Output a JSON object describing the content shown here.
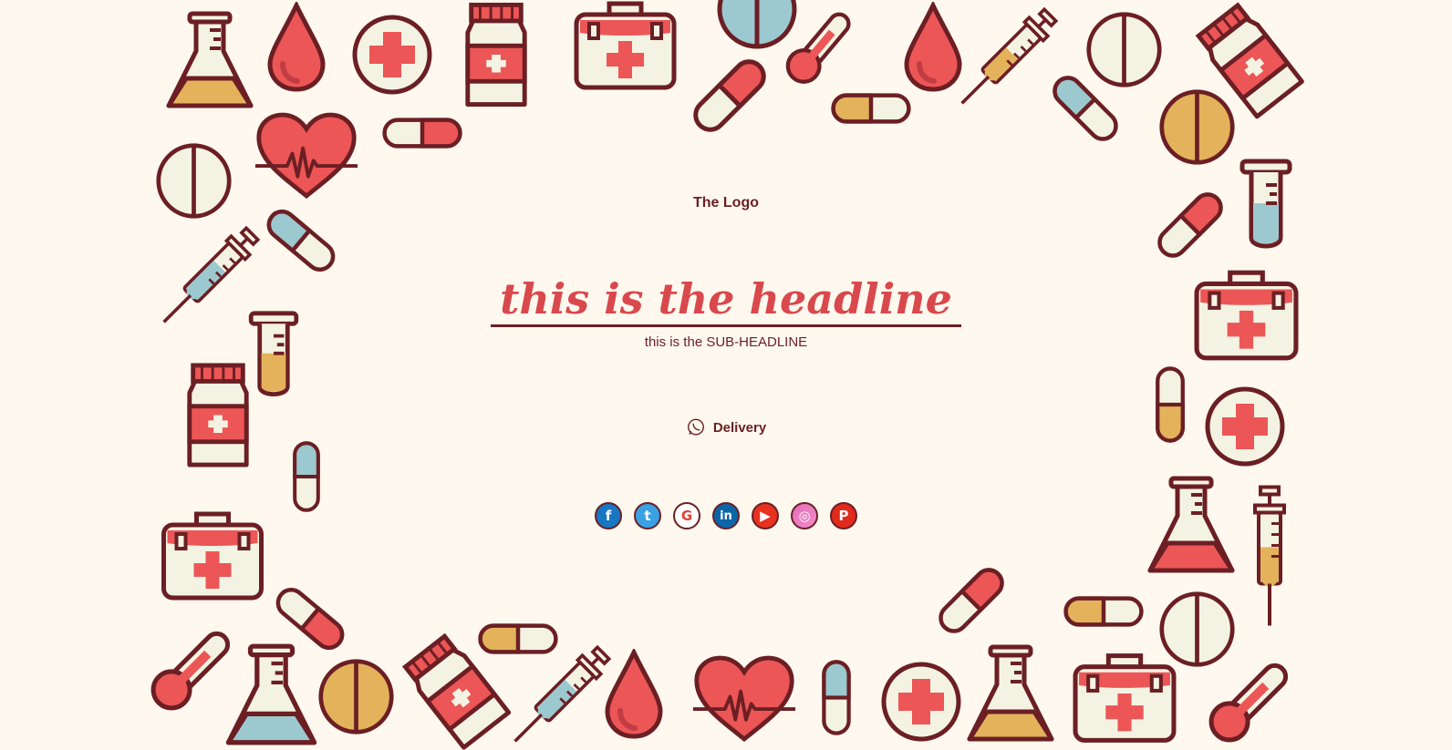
{
  "logo_text": "The Logo",
  "headline": "this is the headline",
  "subheadline": "this is the SUB-HEADLINE",
  "delivery": {
    "label": "Delivery",
    "icon": "whatsapp-icon"
  },
  "social": [
    {
      "name": "facebook",
      "icon": "facebook-icon",
      "glyph": "f"
    },
    {
      "name": "twitter",
      "icon": "twitter-icon",
      "glyph": "t"
    },
    {
      "name": "google",
      "icon": "google-icon",
      "glyph": "G"
    },
    {
      "name": "linkedin",
      "icon": "linkedin-icon",
      "glyph": "in"
    },
    {
      "name": "youtube",
      "icon": "youtube-icon",
      "glyph": "▶"
    },
    {
      "name": "instagram",
      "icon": "instagram-icon",
      "glyph": "◎"
    },
    {
      "name": "pinterest",
      "icon": "pinterest-icon",
      "glyph": "P"
    }
  ],
  "colors": {
    "background": "#fff8ef",
    "outline": "#6b1f24",
    "red": "#ec5656",
    "cream": "#f4f3e3",
    "mustard": "#e3b25a",
    "light_blue": "#9cc8cf"
  }
}
